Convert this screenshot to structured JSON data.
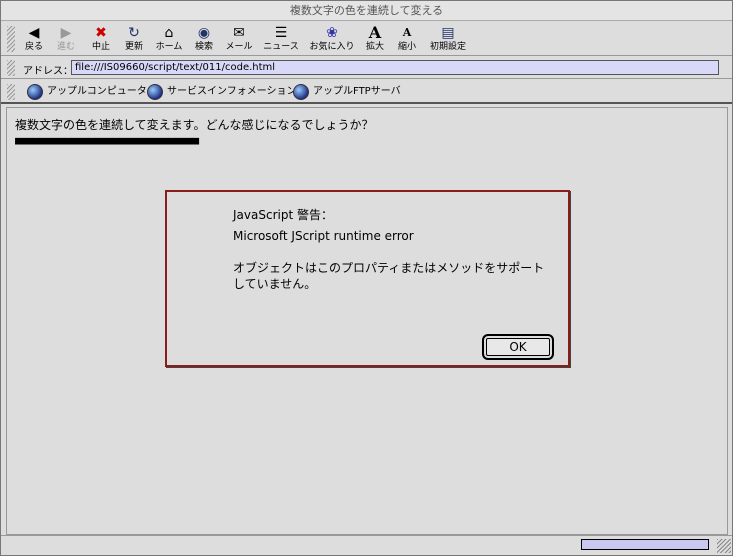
{
  "window": {
    "title": "複数文字の色を連続して変える"
  },
  "toolbar": {
    "buttons": [
      {
        "label": "戻る",
        "icon": "back-arrow-icon",
        "glyph": "◀"
      },
      {
        "label": "進む",
        "icon": "forward-arrow-icon",
        "glyph": "▶"
      },
      {
        "label": "中止",
        "icon": "stop-icon",
        "glyph": "✖"
      },
      {
        "label": "更新",
        "icon": "refresh-icon",
        "glyph": "↻"
      },
      {
        "label": "ホーム",
        "icon": "home-icon",
        "glyph": "⌂"
      },
      {
        "label": "検索",
        "icon": "search-globe-icon",
        "glyph": "◉"
      },
      {
        "label": "メール",
        "icon": "mail-icon",
        "glyph": "✉"
      },
      {
        "label": "ニュース",
        "icon": "news-icon",
        "glyph": "☰"
      },
      {
        "label": "お気に入り",
        "icon": "favorites-icon",
        "glyph": "❀"
      },
      {
        "label": "拡大",
        "icon": "text-larger-icon",
        "glyph": "A"
      },
      {
        "label": "縮小",
        "icon": "text-smaller-icon",
        "glyph": "A"
      },
      {
        "label": "初期設定",
        "icon": "preferences-icon",
        "glyph": "▤"
      }
    ]
  },
  "address": {
    "label": "アドレス：",
    "value": "file:///IS09660/script/text/011/code.html"
  },
  "links": [
    {
      "label": "アップルコンピュータ"
    },
    {
      "label": "サービスインフォメーション"
    },
    {
      "label": "アップルFTPサーバ"
    }
  ],
  "page": {
    "text": "複数文字の色を連続して変えます。どんな感じになるでしょうか？",
    "squares": "■■■■■■■■■■■■■■■■■■■■■■■■■■■■■■"
  },
  "dialog": {
    "title": "JavaScript 警告：",
    "message1": "Microsoft JScript runtime error",
    "message2": "オブジェクトはこのプロパティまたはメソッドをサポートしていません。",
    "ok_label": "OK"
  },
  "colors": {
    "dialog_border": "#8a1c1c",
    "address_field": "#d8d8f8",
    "progress_fill": "#c8c8f0"
  }
}
